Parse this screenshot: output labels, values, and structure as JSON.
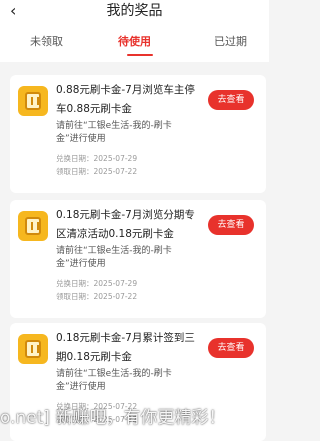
{
  "header": {
    "back_icon": "‹",
    "title": "我的奖品"
  },
  "tabs": [
    {
      "label": "未领取",
      "active": false
    },
    {
      "label": "待使用",
      "active": true
    },
    {
      "label": "已过期",
      "active": false
    }
  ],
  "colors": {
    "accent": "#e8322c",
    "icon_bg": "#f6b71f"
  },
  "cards": [
    {
      "icon": "card-coupon-icon",
      "name": "0.88元刷卡金-7月浏览车主停车0.88元刷卡金",
      "tip": "请前往“工银e生活-我的-刷卡金”进行使用",
      "exchange_date": "兑换日期：2025-07-29",
      "claim_date": "领取日期：2025-07-22",
      "button": "去查看"
    },
    {
      "icon": "card-coupon-icon",
      "name": "0.18元刷卡金-7月浏览分期专区清凉活动0.18元刷卡金",
      "tip": "请前往“工银e生活-我的-刷卡金”进行使用",
      "exchange_date": "兑换日期：2025-07-29",
      "claim_date": "领取日期：2025-07-22",
      "button": "去查看"
    },
    {
      "icon": "card-coupon-icon",
      "name": "0.18元刷卡金-7月累计签到三期0.18元刷卡金",
      "tip": "请前往“工银e生活-我的-刷卡金”进行使用",
      "exchange_date": "兑换日期：2025-07-22",
      "claim_date": "领取日期：2025-07-22",
      "button": "去查看"
    }
  ],
  "watermark": "o.net] 新赚吧，有你更精彩！"
}
